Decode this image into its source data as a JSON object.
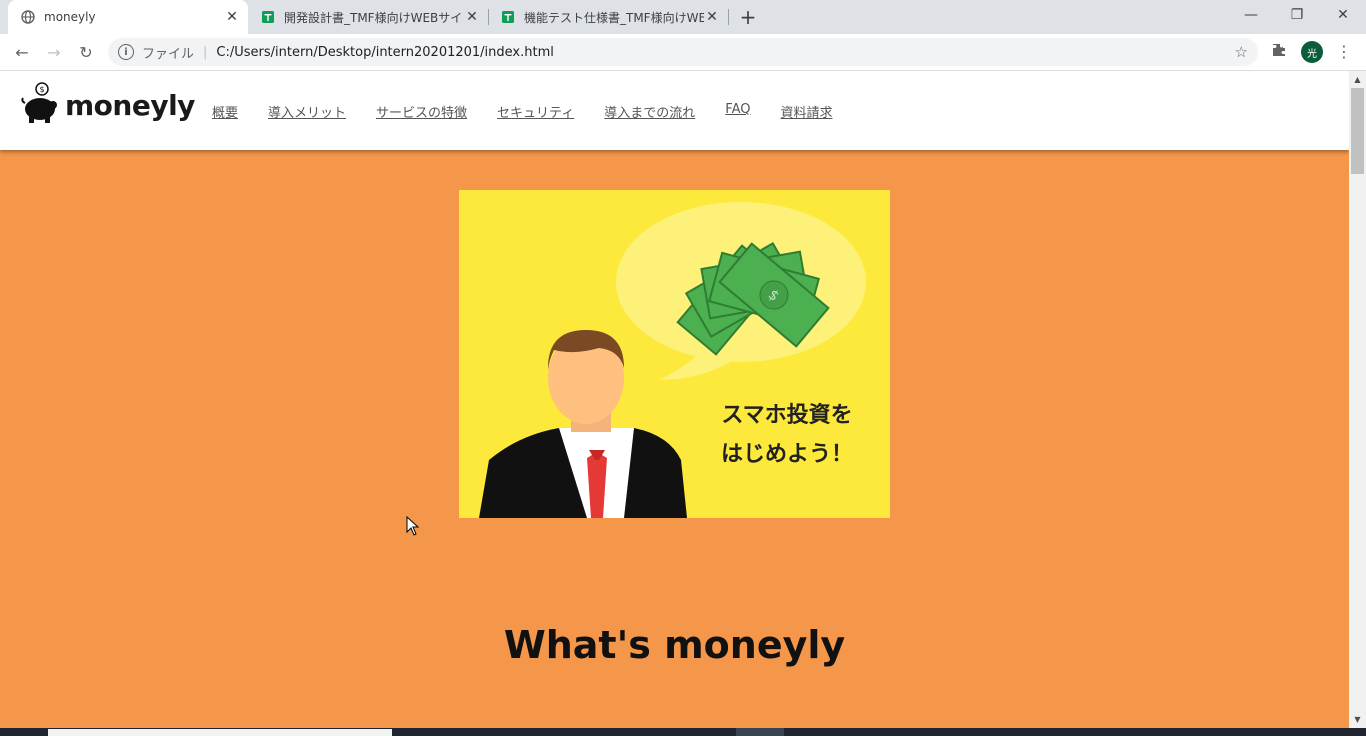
{
  "browser": {
    "tabs": [
      {
        "title": "moneyly",
        "active": true,
        "icon": "globe-icon"
      },
      {
        "title": "開発設計書_TMF様向けWEBサイト",
        "active": false,
        "icon": "sheets-icon"
      },
      {
        "title": "機能テスト仕様書_TMF様向けWEB",
        "active": false,
        "icon": "sheets-icon"
      }
    ],
    "address": {
      "label": "ファイル",
      "url": "C:/Users/intern/Desktop/intern20201201/index.html"
    },
    "profile_initial": "光"
  },
  "site": {
    "logo_text": "moneyly",
    "nav": [
      "概要",
      "導入メリット",
      "サービスの特徴",
      "セキュリティ",
      "導入までの流れ",
      "FAQ",
      "資料請求"
    ],
    "hero": {
      "caption_line1": "スマホ投資を",
      "caption_line2": "はじめよう！"
    },
    "section_title": "What's moneyly"
  },
  "colors": {
    "page_background": "#f5974a",
    "hero_background": "#fde93b",
    "header_background": "#ffffff"
  }
}
